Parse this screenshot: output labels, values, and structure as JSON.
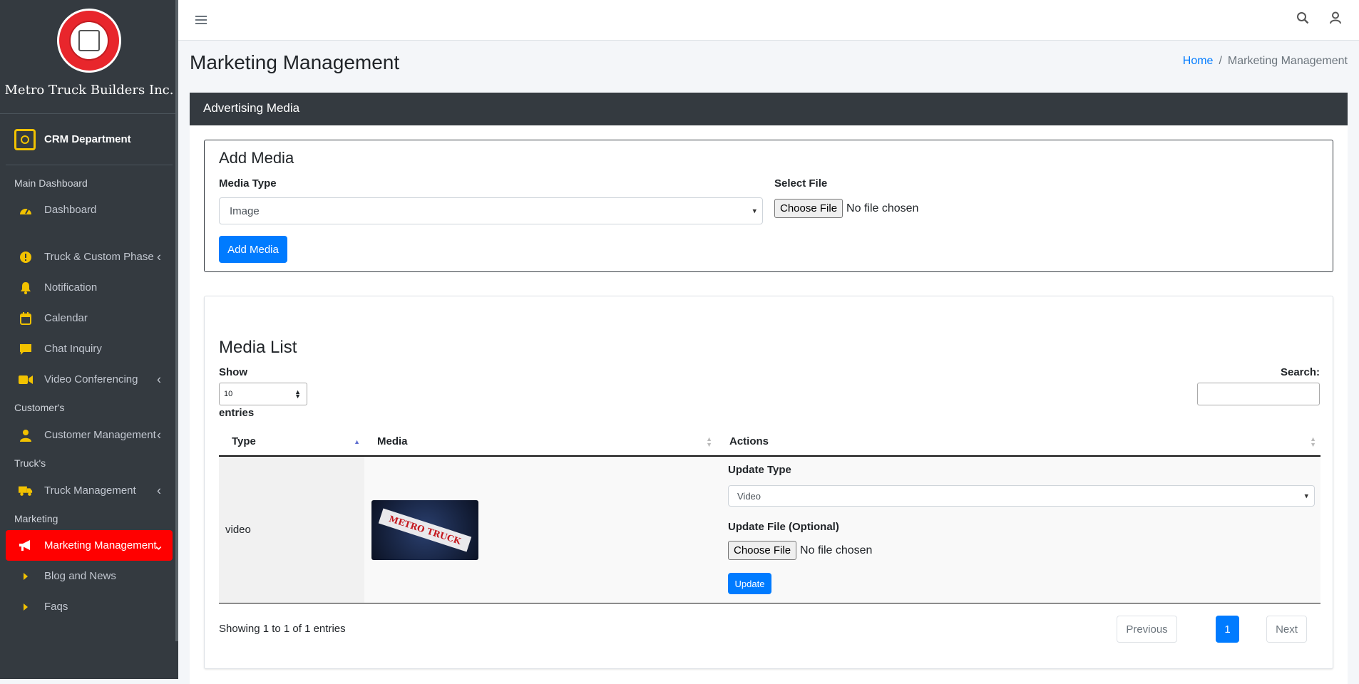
{
  "sidebar": {
    "brand": "Metro Truck Builders Inc.",
    "logo_text": "METRO TRUCK Builders Inc.",
    "department": "CRM Department",
    "sections": {
      "main": "Main Dashboard",
      "customers": "Customer's",
      "trucks": "Truck's",
      "marketing": "Marketing"
    },
    "items": {
      "dashboard": "Dashboard",
      "truck_custom_phase": "Truck & Custom Phase",
      "notification": "Notification",
      "calendar": "Calendar",
      "chat_inquiry": "Chat Inquiry",
      "video_conferencing": "Video Conferencing",
      "customer_management": "Customer Management",
      "truck_management": "Truck Management",
      "marketing_management": "Marketing Management",
      "blog_news": "Blog and News",
      "faqs": "Faqs"
    },
    "active_color": "#ff0000"
  },
  "header": {
    "page_title": "Marketing Management",
    "breadcrumb": {
      "home": "Home",
      "current": "Marketing Management"
    }
  },
  "card": {
    "title": "Advertising Media",
    "add_media": {
      "title": "Add Media",
      "media_type_label": "Media Type",
      "media_type_value": "Image",
      "select_file_label": "Select File",
      "choose_file": "Choose File",
      "no_file": "No file chosen",
      "submit": "Add Media"
    },
    "media_list": {
      "title": "Media List",
      "show_label": "Show",
      "entries_value": "10",
      "entries_label": "entries",
      "search_label": "Search:",
      "columns": {
        "type": "Type",
        "media": "Media",
        "actions": "Actions"
      },
      "rows": [
        {
          "type": "video",
          "thumb_text": "METRO TRUCK",
          "update_type_label": "Update Type",
          "update_type_value": "Video",
          "update_file_label": "Update File (Optional)",
          "choose_file": "Choose File",
          "no_file": "No file chosen",
          "update_btn": "Update"
        }
      ],
      "info": "Showing 1 to 1 of 1 entries",
      "pagination": {
        "previous": "Previous",
        "current": "1",
        "next": "Next"
      }
    }
  },
  "colors": {
    "primary": "#007bff",
    "sidebar_bg": "#343a40",
    "icon_yellow": "#f2c200"
  }
}
